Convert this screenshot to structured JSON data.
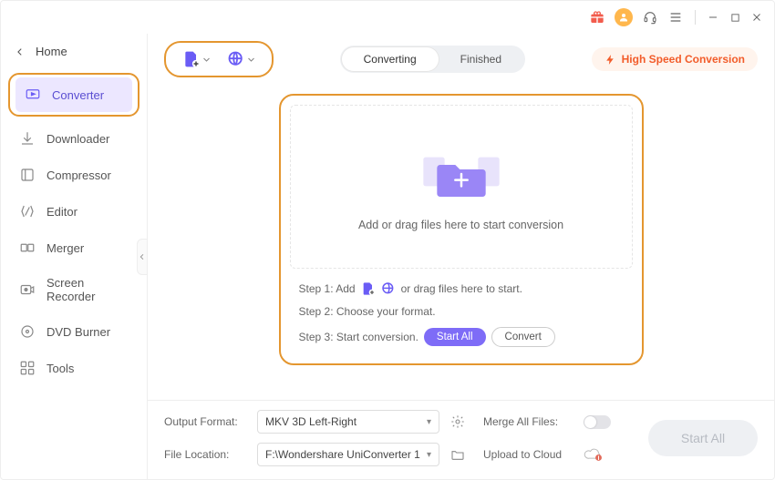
{
  "titlebar": {
    "icons": {
      "gift": "gift",
      "avatar": "avatar",
      "headset": "headset",
      "menu": "menu"
    }
  },
  "sidebar": {
    "home": "Home",
    "items": [
      {
        "label": "Converter",
        "active": true
      },
      {
        "label": "Downloader"
      },
      {
        "label": "Compressor"
      },
      {
        "label": "Editor"
      },
      {
        "label": "Merger"
      },
      {
        "label": "Screen Recorder"
      },
      {
        "label": "DVD Burner"
      },
      {
        "label": "Tools"
      }
    ]
  },
  "toolbar": {
    "tabs": {
      "converting": "Converting",
      "finished": "Finished"
    },
    "high_speed": "High Speed Conversion"
  },
  "drop": {
    "main_text": "Add or drag files here to start conversion",
    "step1_prefix": "Step 1: Add",
    "step1_suffix": "or drag files here to start.",
    "step2": "Step 2: Choose your format.",
    "step3": "Step 3: Start conversion.",
    "start_all": "Start All",
    "convert": "Convert"
  },
  "bottom": {
    "output_format_label": "Output Format:",
    "output_format_value": "MKV 3D Left-Right",
    "merge_label": "Merge All Files:",
    "file_location_label": "File Location:",
    "file_location_value": "F:\\Wondershare UniConverter 1",
    "upload_label": "Upload to Cloud",
    "start_all": "Start All"
  }
}
